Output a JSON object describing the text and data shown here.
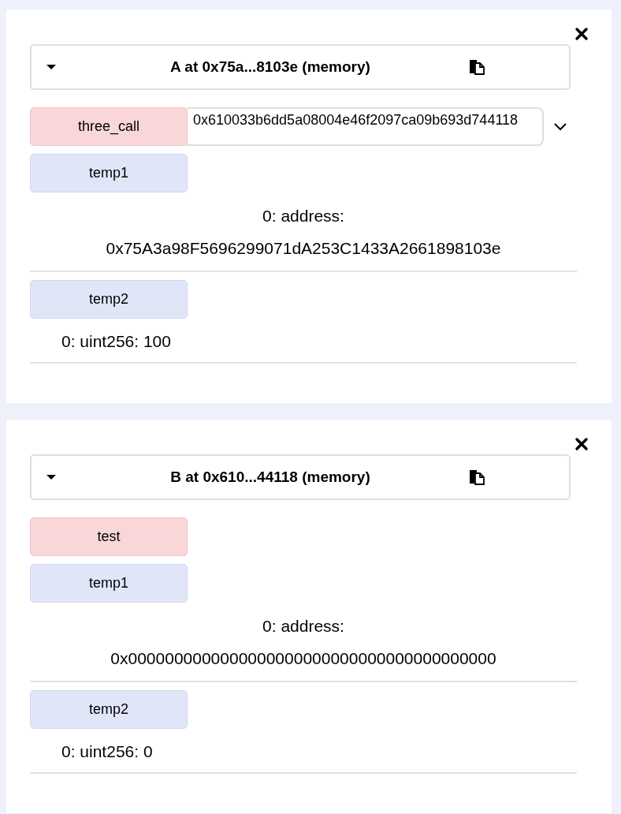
{
  "instances": [
    {
      "title": "A at 0x75a...8103e (memory)",
      "expanded": true,
      "functions": [
        {
          "name": "three_call",
          "kind": "transact",
          "value": "0x610033b6dd5a08004e46f2097ca09b693d744118"
        },
        {
          "name": "temp1",
          "kind": "call",
          "outputs": [
            {
              "kind": "block",
              "lines": [
                "0: address:",
                "0x75A3a98F5696299071dA253C1433A2661898103e"
              ]
            }
          ]
        },
        {
          "name": "temp2",
          "kind": "call",
          "outputs": [
            {
              "kind": "inline",
              "lines": [
                "0: uint256: 100"
              ]
            }
          ]
        }
      ]
    },
    {
      "title": "B at 0x610...44118 (memory)",
      "expanded": true,
      "functions": [
        {
          "name": "test",
          "kind": "transact"
        },
        {
          "name": "temp1",
          "kind": "call",
          "outputs": [
            {
              "kind": "block",
              "lines": [
                "0: address:",
                "0x0000000000000000000000000000000000000000"
              ]
            }
          ]
        },
        {
          "name": "temp2",
          "kind": "call",
          "outputs": [
            {
              "kind": "inline",
              "lines": [
                "0: uint256: 0"
              ]
            }
          ]
        }
      ]
    }
  ]
}
